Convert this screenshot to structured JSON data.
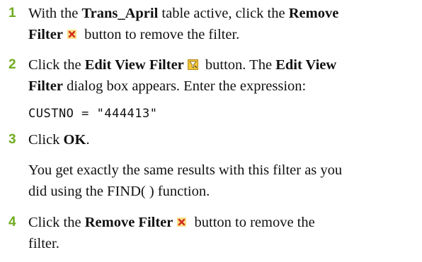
{
  "steps": [
    {
      "number": "1",
      "line1": {
        "pre": "With the ",
        "bold1": "Trans_April",
        "mid": " table active, click the ",
        "bold2": "Remove"
      },
      "line2": {
        "bold": "Filter",
        "post": " button to remove the filter."
      }
    },
    {
      "number": "2",
      "line1": {
        "pre": "Click the ",
        "bold1": "Edit View Filter",
        "mid": " button. The ",
        "bold2": "Edit View"
      },
      "line2": {
        "bold": "Filter",
        "post": " dialog box appears. Enter the expression:"
      },
      "code": "CUSTNO = \"444413\""
    },
    {
      "number": "3",
      "line1": {
        "pre": "Click ",
        "bold1": "OK",
        "post": "."
      },
      "result_line1": "You get exactly the same results with this filter as you",
      "result_line2": "did using the FIND( ) function."
    },
    {
      "number": "4",
      "line1": {
        "pre": "Click the ",
        "bold1": "Remove Filter",
        "post": " button to remove the"
      },
      "line2": {
        "text": "filter."
      }
    }
  ],
  "icons": {
    "remove_filter": "remove-filter-icon",
    "edit_view_filter": "edit-view-filter-icon"
  },
  "colors": {
    "step_number": "#6fab1f",
    "text": "#111111",
    "remove_icon_red": "#d22a1b",
    "icon_yellow": "#f2c53a"
  }
}
